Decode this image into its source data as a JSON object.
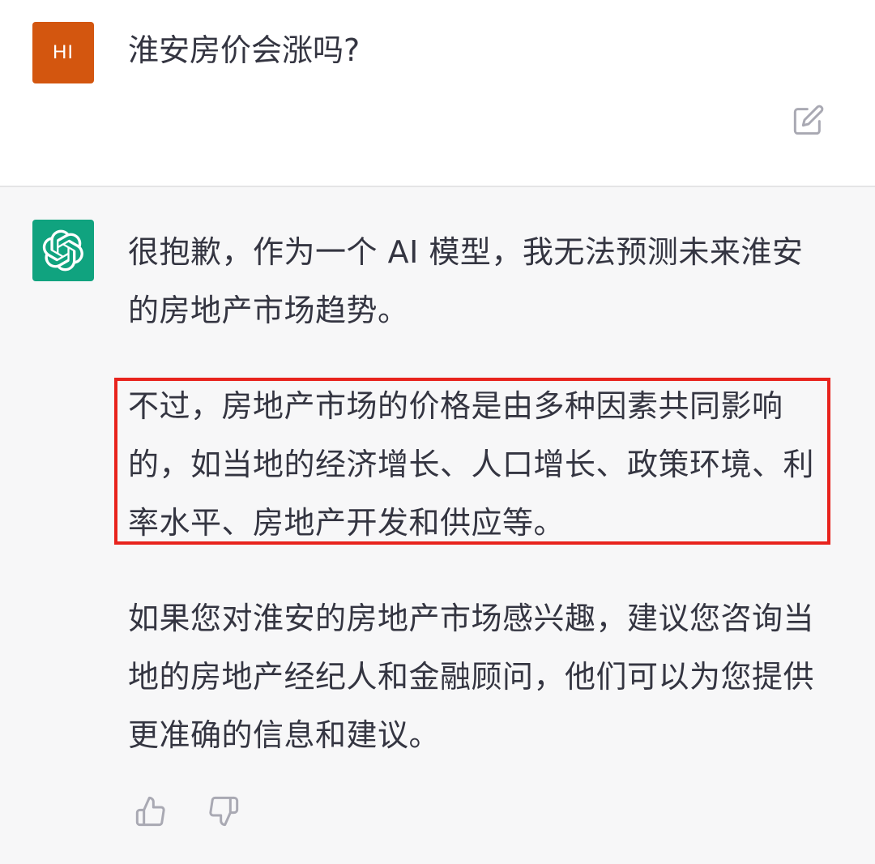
{
  "user_message": {
    "avatar_text": "HI",
    "avatar_color": "#d3560f",
    "text": "淮安房价会涨吗?",
    "edit_icon": "edit-icon"
  },
  "assistant_message": {
    "avatar_icon": "openai-logo-icon",
    "avatar_color": "#10a37f",
    "paragraphs": [
      "很抱歉，作为一个 AI 模型，我无法预测未来淮安的房地产市场趋势。",
      "不过，房地产市场的价格是由多种因素共同影响的，如当地的经济增长、人口增长、政策环境、利率水平、房地产开发和供应等。",
      "如果您对淮安的房地产市场感兴趣，建议您咨询当地的房地产经纪人和金融顾问，他们可以为您提供更准确的信息和建议。"
    ],
    "highlight_color": "#e8231d",
    "feedback": {
      "like_icon": "thumbs-up-icon",
      "dislike_icon": "thumbs-down-icon"
    }
  }
}
